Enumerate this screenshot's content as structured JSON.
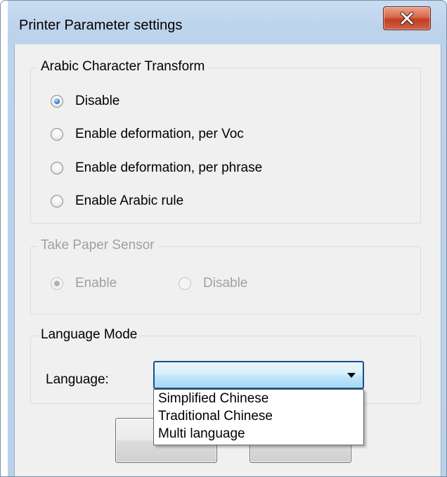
{
  "window": {
    "title": "Printer Parameter settings",
    "close_glyph": "x"
  },
  "arabic_group": {
    "title": "Arabic Character Transform",
    "options": [
      {
        "label": "Disable",
        "checked": true
      },
      {
        "label": "Enable deformation, per Voc",
        "checked": false
      },
      {
        "label": "Enable deformation, per phrase",
        "checked": false
      },
      {
        "label": "Enable Arabic rule",
        "checked": false
      }
    ]
  },
  "paper_sensor_group": {
    "title": "Take Paper Sensor",
    "enabled": false,
    "options": [
      {
        "label": "Enable",
        "checked": true
      },
      {
        "label": "Disable",
        "checked": false
      }
    ]
  },
  "language_group": {
    "title": "Language Mode",
    "field_label": "Language:",
    "selected_value": "",
    "dropdown_open": true,
    "options": [
      "Simplified Chinese",
      "Traditional Chinese",
      "Multi language"
    ]
  },
  "buttons": {
    "ok_label": "",
    "cancel_label": ""
  },
  "colors": {
    "frame": "#b9d1ea",
    "client": "#f0f0f0",
    "close_button": "#c13d22",
    "combo_focus": "#1a4d8a"
  }
}
